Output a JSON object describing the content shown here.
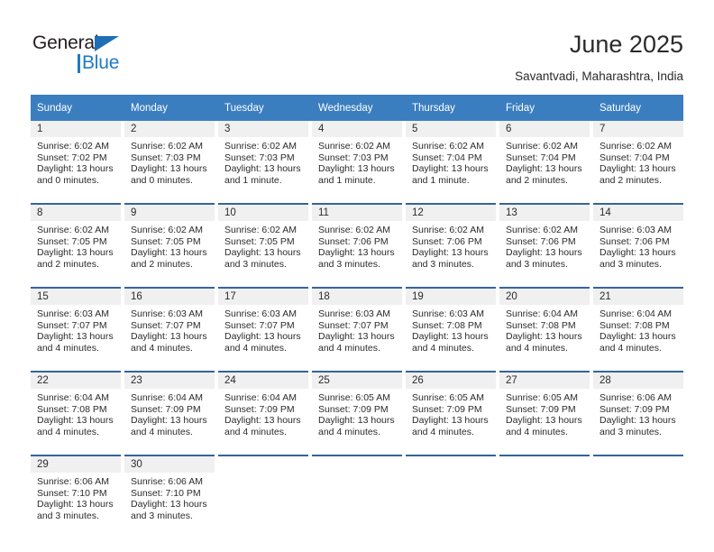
{
  "logo": {
    "word_top": "General",
    "word_bottom": "Blue",
    "triangle_color": "#1f6fb5",
    "blue_color": "#1f7ac4"
  },
  "header": {
    "title": "June 2025",
    "subtitle": "Savantvadi, Maharashtra, India"
  },
  "colors": {
    "header_blue": "#3b7ec0",
    "row_divider": "#35649c",
    "daynum_band": "#f0f0f0",
    "text": "#2b2b2b"
  },
  "weekday_headers": [
    "Sunday",
    "Monday",
    "Tuesday",
    "Wednesday",
    "Thursday",
    "Friday",
    "Saturday"
  ],
  "labels": {
    "sunrise_prefix": "Sunrise:",
    "sunset_prefix": "Sunset:",
    "daylight_prefix": "Daylight:"
  },
  "weeks": [
    [
      {
        "day": "1",
        "sunrise": "Sunrise: 6:02 AM",
        "sunset": "Sunset: 7:02 PM",
        "daylight1": "Daylight: 13 hours",
        "daylight2": "and 0 minutes."
      },
      {
        "day": "2",
        "sunrise": "Sunrise: 6:02 AM",
        "sunset": "Sunset: 7:03 PM",
        "daylight1": "Daylight: 13 hours",
        "daylight2": "and 0 minutes."
      },
      {
        "day": "3",
        "sunrise": "Sunrise: 6:02 AM",
        "sunset": "Sunset: 7:03 PM",
        "daylight1": "Daylight: 13 hours",
        "daylight2": "and 1 minute."
      },
      {
        "day": "4",
        "sunrise": "Sunrise: 6:02 AM",
        "sunset": "Sunset: 7:03 PM",
        "daylight1": "Daylight: 13 hours",
        "daylight2": "and 1 minute."
      },
      {
        "day": "5",
        "sunrise": "Sunrise: 6:02 AM",
        "sunset": "Sunset: 7:04 PM",
        "daylight1": "Daylight: 13 hours",
        "daylight2": "and 1 minute."
      },
      {
        "day": "6",
        "sunrise": "Sunrise: 6:02 AM",
        "sunset": "Sunset: 7:04 PM",
        "daylight1": "Daylight: 13 hours",
        "daylight2": "and 2 minutes."
      },
      {
        "day": "7",
        "sunrise": "Sunrise: 6:02 AM",
        "sunset": "Sunset: 7:04 PM",
        "daylight1": "Daylight: 13 hours",
        "daylight2": "and 2 minutes."
      }
    ],
    [
      {
        "day": "8",
        "sunrise": "Sunrise: 6:02 AM",
        "sunset": "Sunset: 7:05 PM",
        "daylight1": "Daylight: 13 hours",
        "daylight2": "and 2 minutes."
      },
      {
        "day": "9",
        "sunrise": "Sunrise: 6:02 AM",
        "sunset": "Sunset: 7:05 PM",
        "daylight1": "Daylight: 13 hours",
        "daylight2": "and 2 minutes."
      },
      {
        "day": "10",
        "sunrise": "Sunrise: 6:02 AM",
        "sunset": "Sunset: 7:05 PM",
        "daylight1": "Daylight: 13 hours",
        "daylight2": "and 3 minutes."
      },
      {
        "day": "11",
        "sunrise": "Sunrise: 6:02 AM",
        "sunset": "Sunset: 7:06 PM",
        "daylight1": "Daylight: 13 hours",
        "daylight2": "and 3 minutes."
      },
      {
        "day": "12",
        "sunrise": "Sunrise: 6:02 AM",
        "sunset": "Sunset: 7:06 PM",
        "daylight1": "Daylight: 13 hours",
        "daylight2": "and 3 minutes."
      },
      {
        "day": "13",
        "sunrise": "Sunrise: 6:02 AM",
        "sunset": "Sunset: 7:06 PM",
        "daylight1": "Daylight: 13 hours",
        "daylight2": "and 3 minutes."
      },
      {
        "day": "14",
        "sunrise": "Sunrise: 6:03 AM",
        "sunset": "Sunset: 7:06 PM",
        "daylight1": "Daylight: 13 hours",
        "daylight2": "and 3 minutes."
      }
    ],
    [
      {
        "day": "15",
        "sunrise": "Sunrise: 6:03 AM",
        "sunset": "Sunset: 7:07 PM",
        "daylight1": "Daylight: 13 hours",
        "daylight2": "and 4 minutes."
      },
      {
        "day": "16",
        "sunrise": "Sunrise: 6:03 AM",
        "sunset": "Sunset: 7:07 PM",
        "daylight1": "Daylight: 13 hours",
        "daylight2": "and 4 minutes."
      },
      {
        "day": "17",
        "sunrise": "Sunrise: 6:03 AM",
        "sunset": "Sunset: 7:07 PM",
        "daylight1": "Daylight: 13 hours",
        "daylight2": "and 4 minutes."
      },
      {
        "day": "18",
        "sunrise": "Sunrise: 6:03 AM",
        "sunset": "Sunset: 7:07 PM",
        "daylight1": "Daylight: 13 hours",
        "daylight2": "and 4 minutes."
      },
      {
        "day": "19",
        "sunrise": "Sunrise: 6:03 AM",
        "sunset": "Sunset: 7:08 PM",
        "daylight1": "Daylight: 13 hours",
        "daylight2": "and 4 minutes."
      },
      {
        "day": "20",
        "sunrise": "Sunrise: 6:04 AM",
        "sunset": "Sunset: 7:08 PM",
        "daylight1": "Daylight: 13 hours",
        "daylight2": "and 4 minutes."
      },
      {
        "day": "21",
        "sunrise": "Sunrise: 6:04 AM",
        "sunset": "Sunset: 7:08 PM",
        "daylight1": "Daylight: 13 hours",
        "daylight2": "and 4 minutes."
      }
    ],
    [
      {
        "day": "22",
        "sunrise": "Sunrise: 6:04 AM",
        "sunset": "Sunset: 7:08 PM",
        "daylight1": "Daylight: 13 hours",
        "daylight2": "and 4 minutes."
      },
      {
        "day": "23",
        "sunrise": "Sunrise: 6:04 AM",
        "sunset": "Sunset: 7:09 PM",
        "daylight1": "Daylight: 13 hours",
        "daylight2": "and 4 minutes."
      },
      {
        "day": "24",
        "sunrise": "Sunrise: 6:04 AM",
        "sunset": "Sunset: 7:09 PM",
        "daylight1": "Daylight: 13 hours",
        "daylight2": "and 4 minutes."
      },
      {
        "day": "25",
        "sunrise": "Sunrise: 6:05 AM",
        "sunset": "Sunset: 7:09 PM",
        "daylight1": "Daylight: 13 hours",
        "daylight2": "and 4 minutes."
      },
      {
        "day": "26",
        "sunrise": "Sunrise: 6:05 AM",
        "sunset": "Sunset: 7:09 PM",
        "daylight1": "Daylight: 13 hours",
        "daylight2": "and 4 minutes."
      },
      {
        "day": "27",
        "sunrise": "Sunrise: 6:05 AM",
        "sunset": "Sunset: 7:09 PM",
        "daylight1": "Daylight: 13 hours",
        "daylight2": "and 4 minutes."
      },
      {
        "day": "28",
        "sunrise": "Sunrise: 6:06 AM",
        "sunset": "Sunset: 7:09 PM",
        "daylight1": "Daylight: 13 hours",
        "daylight2": "and 3 minutes."
      }
    ],
    [
      {
        "day": "29",
        "sunrise": "Sunrise: 6:06 AM",
        "sunset": "Sunset: 7:10 PM",
        "daylight1": "Daylight: 13 hours",
        "daylight2": "and 3 minutes."
      },
      {
        "day": "30",
        "sunrise": "Sunrise: 6:06 AM",
        "sunset": "Sunset: 7:10 PM",
        "daylight1": "Daylight: 13 hours",
        "daylight2": "and 3 minutes."
      },
      {
        "day": "",
        "sunrise": "",
        "sunset": "",
        "daylight1": "",
        "daylight2": ""
      },
      {
        "day": "",
        "sunrise": "",
        "sunset": "",
        "daylight1": "",
        "daylight2": ""
      },
      {
        "day": "",
        "sunrise": "",
        "sunset": "",
        "daylight1": "",
        "daylight2": ""
      },
      {
        "day": "",
        "sunrise": "",
        "sunset": "",
        "daylight1": "",
        "daylight2": ""
      },
      {
        "day": "",
        "sunrise": "",
        "sunset": "",
        "daylight1": "",
        "daylight2": ""
      }
    ]
  ]
}
